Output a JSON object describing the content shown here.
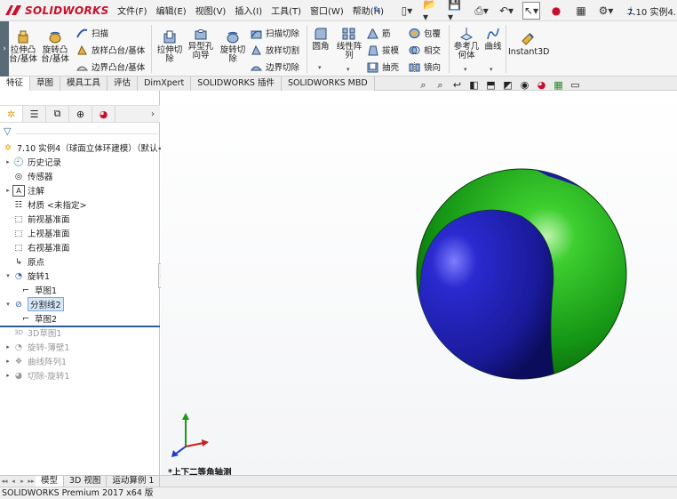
{
  "app": {
    "brand": "SOLIDWORKS"
  },
  "menu": [
    "文件(F)",
    "编辑(E)",
    "视图(V)",
    "插入(I)",
    "工具(T)",
    "窗口(W)",
    "帮助(H)"
  ],
  "quick_access_icons": [
    "new-icon",
    "open-icon",
    "save-icon",
    "print-icon",
    "undo-icon",
    "select-icon",
    "rebuild-icon",
    "file-properties-icon",
    "options-icon"
  ],
  "document": {
    "title": "7.10 实例4..."
  },
  "ribbon": {
    "extrude_boss": "拉伸凸\n台/基体",
    "revolve_boss": "旋转凸\n台/基体",
    "sweep": "扫描",
    "loft_boss": "放样凸台/基体",
    "boundary_boss": "边界凸台/基体",
    "extrude_cut": "拉伸切\n除",
    "hole_wizard": "异型孔\n向导",
    "revolve_cut": "旋转切\n除",
    "sweep_cut": "扫描切除",
    "loft_cut": "放样切割",
    "boundary_cut": "边界切除",
    "fillet": "圆角",
    "linear_pattern": "线性阵\n列",
    "rib": "筋",
    "draft": "拔模",
    "shell": "抽壳",
    "wrap": "包覆",
    "intersect": "相交",
    "mirror": "镜向",
    "ref_geometry": "参考几\n何体",
    "curves": "曲线",
    "instant3d": "Instant3D"
  },
  "tabs": [
    "特征",
    "草图",
    "模具工具",
    "评估",
    "DimXpert",
    "SOLIDWORKS 插件",
    "SOLIDWORKS MBD"
  ],
  "tree": {
    "root": "7.10 实例4（球面立体环建模）（默认<<",
    "items": [
      {
        "label": "历史记录"
      },
      {
        "label": "传感器"
      },
      {
        "label": "注解"
      },
      {
        "label": "材质 <未指定>"
      },
      {
        "label": "前视基准面"
      },
      {
        "label": "上视基准面"
      },
      {
        "label": "右视基准面"
      },
      {
        "label": "原点"
      },
      {
        "label": "旋转1"
      },
      {
        "label": "草图1"
      },
      {
        "label": "分割线2"
      },
      {
        "label": "草图2"
      },
      {
        "label": "3D草图1"
      },
      {
        "label": "旋转-薄壁1"
      },
      {
        "label": "曲线阵列1"
      },
      {
        "label": "切除-旋转1"
      }
    ]
  },
  "bottom_tabs": [
    "模型",
    "3D 视图",
    "运动算例 1"
  ],
  "viewport": {
    "view_label": "*上下二等角轴测"
  },
  "status": {
    "text": "SOLIDWORKS Premium 2017 x64 版"
  },
  "colors": {
    "brand_red": "#c8102e",
    "sphere_green": "#14a014",
    "sphere_blue": "#1c1c9e",
    "selection_blue": "#d7e8f8"
  }
}
